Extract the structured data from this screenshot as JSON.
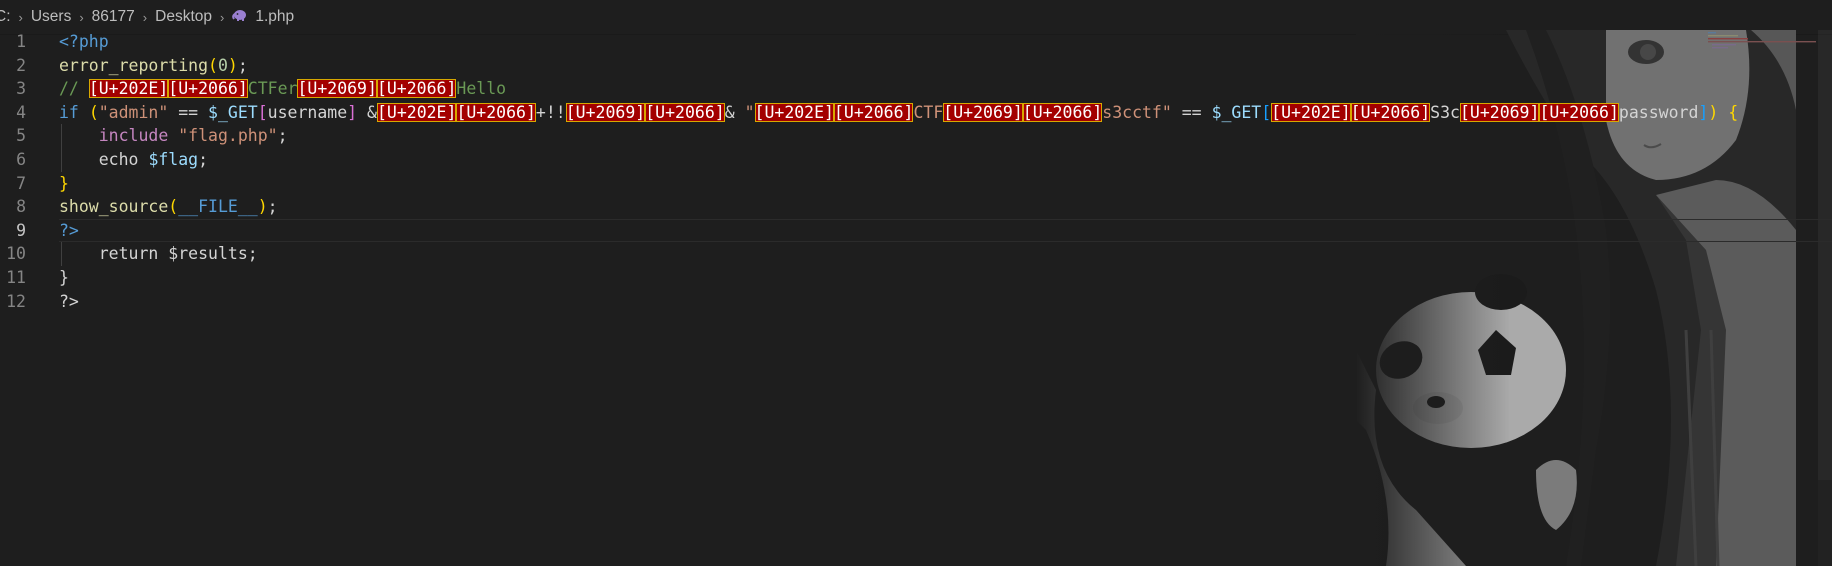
{
  "breadcrumb": {
    "items": [
      "C:",
      "Users",
      "86177",
      "Desktop"
    ],
    "file": "1.php",
    "separator": "›"
  },
  "editor": {
    "line_numbers": [
      "1",
      "2",
      "3",
      "4",
      "5",
      "6",
      "7",
      "8",
      "9",
      "10",
      "11",
      "12"
    ],
    "current_line": "9",
    "lines": {
      "l1": {
        "open_tag": "<?php"
      },
      "l2": {
        "fn": "error_reporting",
        "p_open": "(",
        "num": "0",
        "p_close": ")",
        "semi": ";"
      },
      "l3": {
        "comment": "// ",
        "u1": "[U+202E]",
        "u2": "[U+2066]",
        "t1": "CTFer",
        "u3": "[U+2069]",
        "u4": "[U+2066]",
        "t2": "Hello"
      },
      "l4": {
        "kw_if": "if",
        "p_open": "(",
        "s_admin": "\"admin\"",
        "op_eq1": " == ",
        "get1": "$_GET",
        "b1_open": "[",
        "key1": "username",
        "b1_close": "]",
        "amp_a": " &",
        "u1": "[U+202E]",
        "u2": "[U+2066]",
        "ops": "+!!",
        "u3": "[U+2069]",
        "u4": "[U+2066]",
        "amp_b": "& ",
        "q_open": "\"",
        "u5": "[U+202E]",
        "u6": "[U+2066]",
        "s_ctf": "CTF",
        "u7": "[U+2069]",
        "u8": "[U+2066]",
        "s_tail": "s3cctf\"",
        "op_eq2": " == ",
        "get2": "$_GET",
        "b2_open": "[",
        "u9": "[U+202E]",
        "u10": "[U+2066]",
        "k_s3c": "S3c",
        "u11": "[U+2069]",
        "u12": "[U+2066]",
        "k_pw": "password",
        "b2_close": "]",
        "p_close": ")",
        "brace": " {"
      },
      "l5": {
        "kw": "include",
        "str": "\"flag.php\"",
        "semi": ";"
      },
      "l6": {
        "kw": "echo",
        "var": "$flag",
        "semi": ";"
      },
      "l7": {
        "brace": "}"
      },
      "l8": {
        "fn": "show_source",
        "p_open": "(",
        "const": "__FILE__",
        "p_close": ")",
        "semi": ";"
      },
      "l9": {
        "close_tag": "?>"
      },
      "l10": {
        "text": "return $results;"
      },
      "l11": {
        "brace": "}"
      },
      "l12": {
        "text": "?>"
      }
    }
  },
  "colors": {
    "background": "#1e1e1e",
    "unicode_highlight_bg": "#a30000",
    "unicode_highlight_border": "#d7a800"
  },
  "icons": [
    "chevron-right-icon",
    "php-elephant-icon"
  ]
}
